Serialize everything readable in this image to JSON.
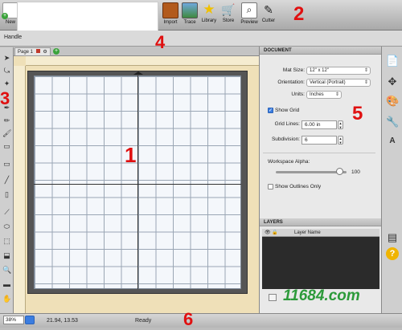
{
  "toolbar": {
    "new_label": "New",
    "import_label": "Import",
    "trace_label": "Trace",
    "library_label": "Library",
    "store_label": "Store",
    "preview_label": "Preview",
    "cutter_label": "Cutter"
  },
  "subbar": {
    "handle_label": "Handle"
  },
  "page_tab": {
    "label": "Page 1"
  },
  "annotations": [
    "1",
    "2",
    "3",
    "4",
    "5",
    "6"
  ],
  "document_panel": {
    "title": "DOCUMENT",
    "mat_size_label": "Mat Size:",
    "mat_size_value": "12\" x 12\"",
    "orientation_label": "Orientation:",
    "orientation_value": "Vertical (Portrait)",
    "units_label": "Units:",
    "units_value": "Inches",
    "show_grid_label": "Show Grid",
    "show_grid_checked": true,
    "grid_lines_label": "Grid Lines:",
    "grid_lines_value": "6.00 in",
    "subdivision_label": "Subdivision:",
    "subdivision_value": "6",
    "workspace_alpha_label": "Workspace Alpha:",
    "workspace_alpha_value": "100",
    "workspace_alpha_level": 0.9,
    "show_outlines_label": "Show Outlines Only",
    "show_outlines_checked": false
  },
  "layers_panel": {
    "title": "LAYERS",
    "column_name": "Layer Name"
  },
  "status": {
    "zoom": "38%",
    "coords": "21.94, 13.53",
    "state": "Ready"
  },
  "watermark": "11684.com",
  "colors": {
    "annotation": "#e01010",
    "accent": "#3b7de0",
    "watermark": "#2c9a3a"
  }
}
